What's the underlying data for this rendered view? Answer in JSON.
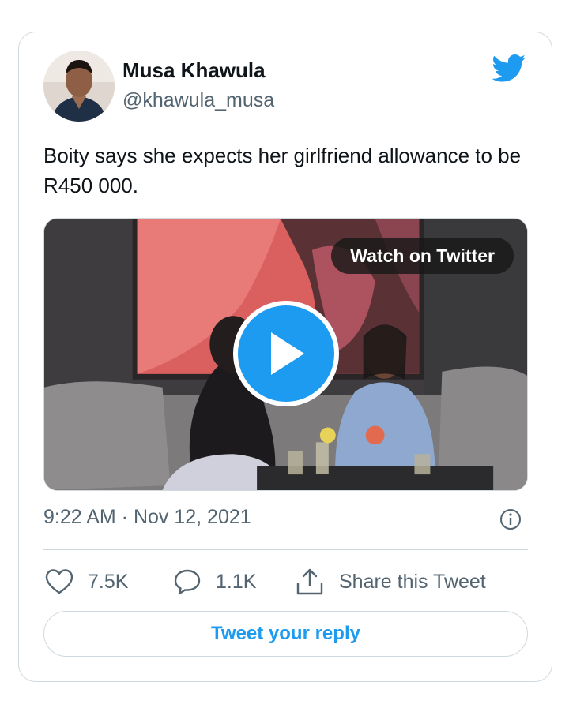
{
  "author": {
    "name": "Musa Khawula",
    "handle": "@khawula_musa"
  },
  "tweet": {
    "text": "Boity says she expects her girlfriend allowance to be R450 000."
  },
  "media": {
    "watch_label": "Watch on Twitter",
    "play_icon": "play-icon"
  },
  "meta": {
    "timestamp": "9:22 AM · Nov 12, 2021"
  },
  "actions": {
    "likes": "7.5K",
    "replies": "1.1K",
    "share_label": "Share this Tweet"
  },
  "reply_button_label": "Tweet your reply",
  "colors": {
    "brand": "#1d9bf0",
    "secondary_text": "#536471",
    "border": "#cfd9de"
  }
}
